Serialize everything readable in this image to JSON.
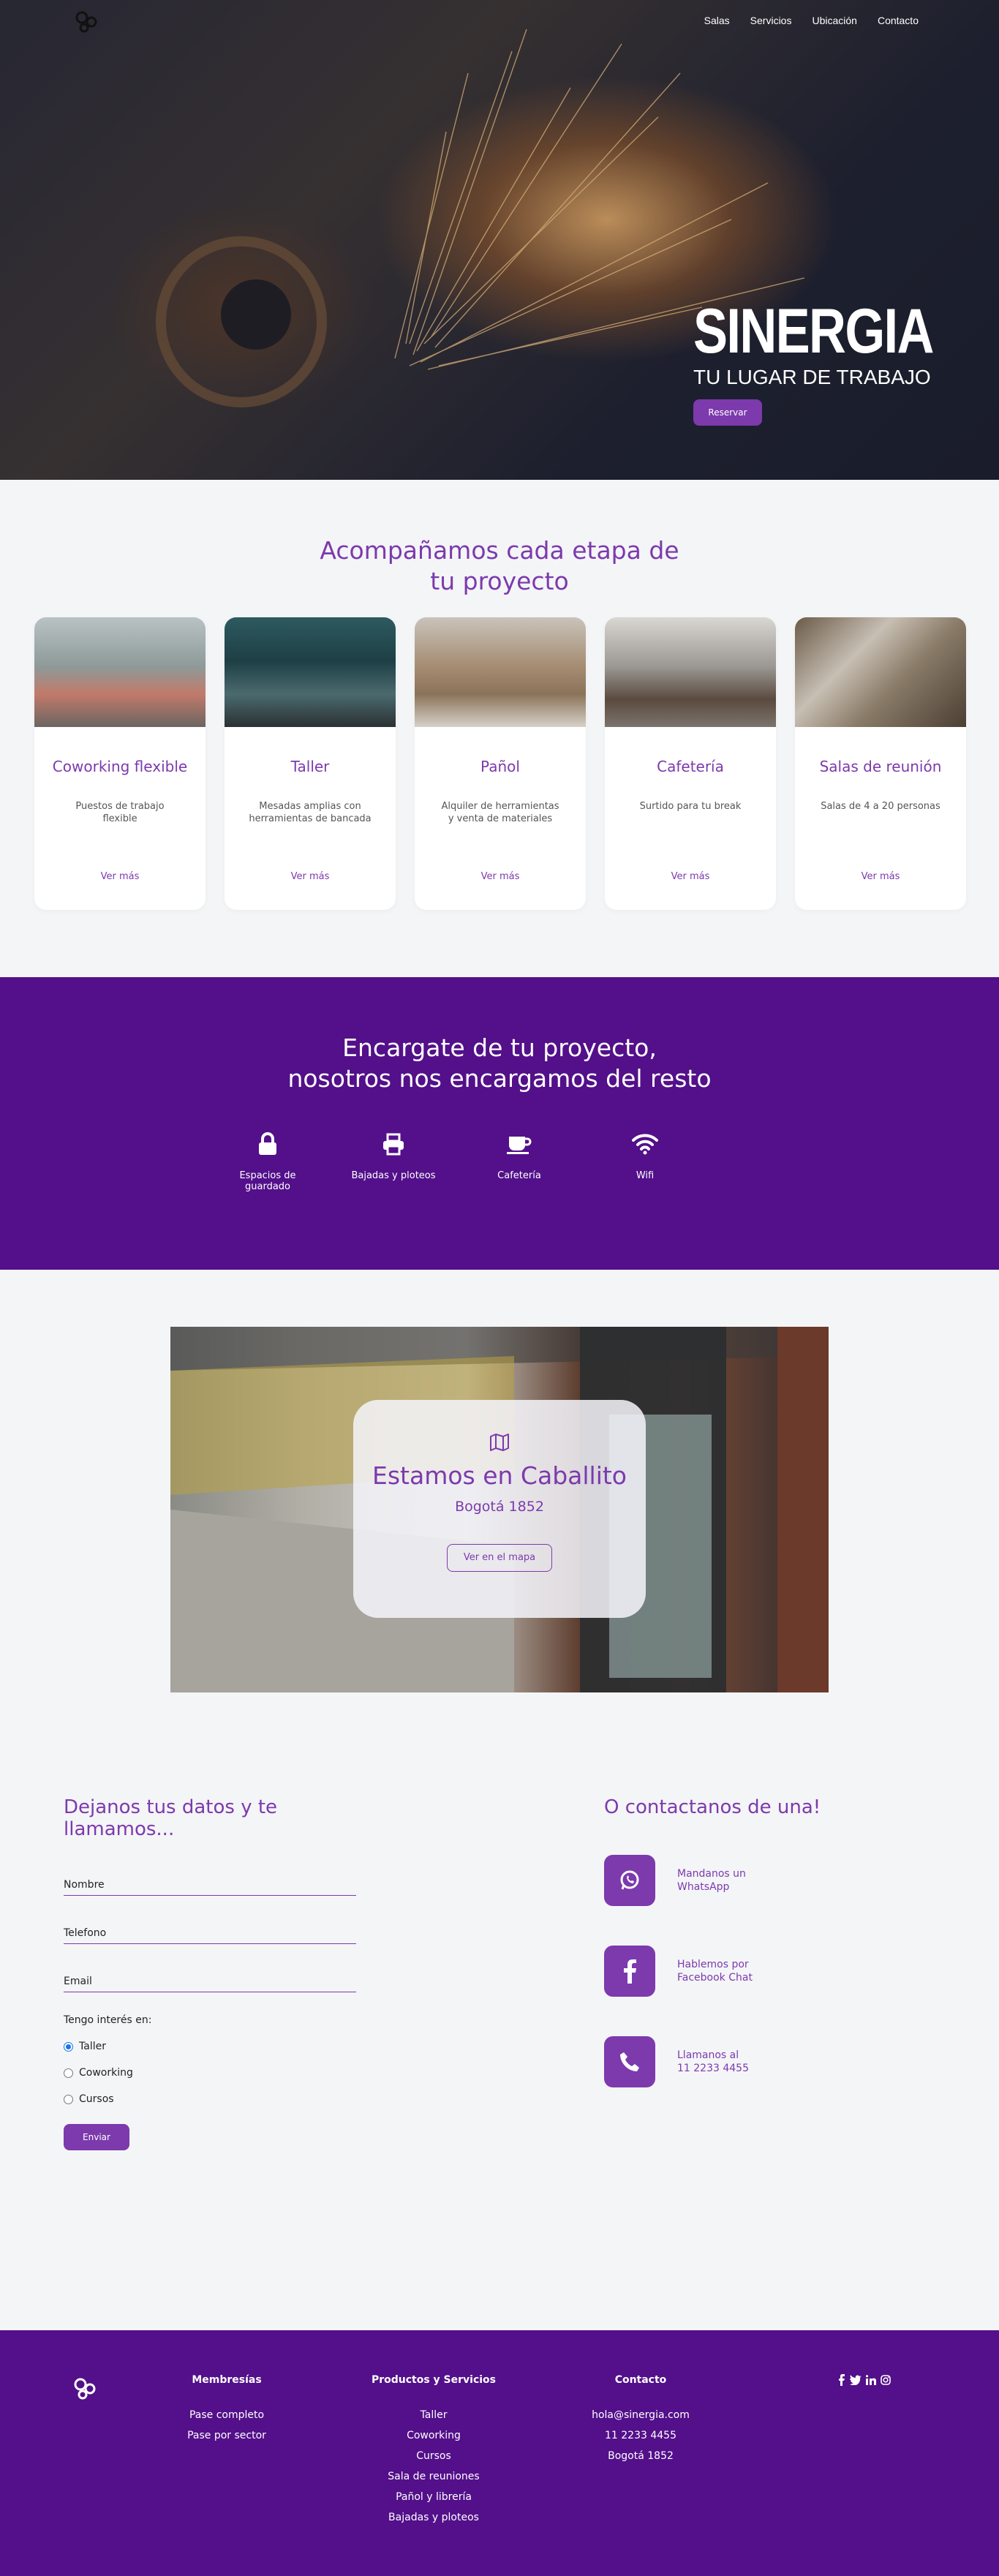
{
  "brand": {
    "logo": "gear-icon"
  },
  "nav": {
    "items": [
      "Salas",
      "Servicios",
      "Ubicación",
      "Contacto"
    ]
  },
  "hero": {
    "title": "SINERGIA",
    "subtitle": "TU LUGAR DE TRABAJO",
    "cta": "Reservar"
  },
  "services": {
    "title": "Acompañamos cada etapa de tu proyecto",
    "cards": [
      {
        "title": "Coworking flexible",
        "desc": "Puestos de trabajo flexible",
        "link": "Ver más"
      },
      {
        "title": "Taller",
        "desc": "Mesadas amplias con herramientas de bancada",
        "link": "Ver más"
      },
      {
        "title": "Pañol",
        "desc": "Alquiler de herramientas y venta de materiales",
        "link": "Ver más"
      },
      {
        "title": "Cafetería",
        "desc": "Surtido para tu break",
        "link": "Ver más"
      },
      {
        "title": "Salas de reunión",
        "desc": "Salas de 4 a 20 personas",
        "link": "Ver más"
      }
    ]
  },
  "amenities": {
    "title_line1": "Encargate de tu proyecto,",
    "title_line2": "nosotros nos encargamos del resto",
    "items": [
      {
        "icon": "lock-icon",
        "label": "Espacios de guardado"
      },
      {
        "icon": "printer-icon",
        "label": "Bajadas y ploteos"
      },
      {
        "icon": "coffee-icon",
        "label": "Cafetería"
      },
      {
        "icon": "wifi-icon",
        "label": "Wifi"
      }
    ]
  },
  "location": {
    "icon": "map-icon",
    "title": "Estamos en Caballito",
    "address": "Bogotá 1852",
    "cta": "Ver en el mapa"
  },
  "contact_form": {
    "title": "Dejanos tus datos y te llamamos...",
    "fields": [
      "Nombre",
      "Telefono",
      "Email"
    ],
    "interest_label": "Tengo interés en:",
    "options": [
      "Taller",
      "Coworking",
      "Cursos"
    ],
    "selected": "Taller",
    "submit": "Enviar"
  },
  "contact_direct": {
    "title": "O contactanos de una!",
    "items": [
      {
        "icon": "whatsapp-icon",
        "line1": "Mandanos un",
        "line2": "WhatsApp"
      },
      {
        "icon": "facebook-icon",
        "line1": "Hablemos por",
        "line2": "Facebook Chat"
      },
      {
        "icon": "phone-icon",
        "line1": "Llamanos al",
        "line2": "11 2233 4455"
      }
    ]
  },
  "footer": {
    "memberships": {
      "title": "Membresías",
      "items": [
        "Pase completo",
        "Pase por sector"
      ]
    },
    "products": {
      "title": "Productos y Servicios",
      "items": [
        "Taller",
        "Coworking",
        "Cursos",
        "Sala de reuniones",
        "Pañol y librería",
        "Bajadas y ploteos"
      ]
    },
    "contact": {
      "title": "Contacto",
      "items": [
        "hola@sinergia.com",
        "11 2233 4455",
        "Bogotá 1852"
      ]
    },
    "social": [
      "facebook-icon",
      "twitter-icon",
      "linkedin-icon",
      "instagram-icon"
    ]
  },
  "colors": {
    "accent": "#7c3aad",
    "dark_purple": "#53108a",
    "background": "#f4f5f7"
  }
}
